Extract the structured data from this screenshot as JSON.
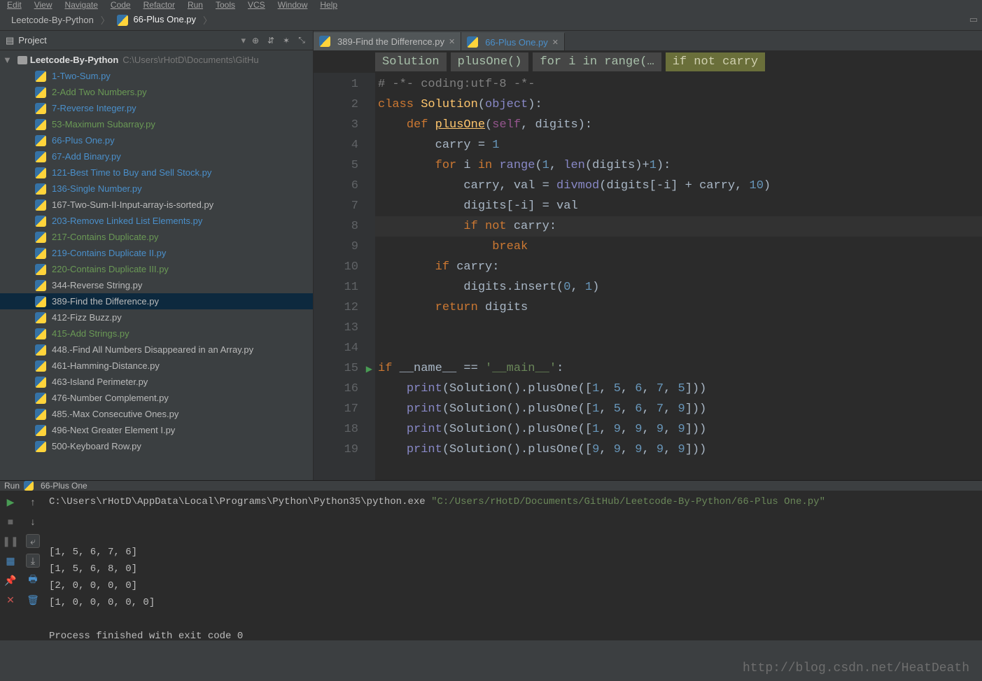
{
  "menu": [
    "Edit",
    "View",
    "Navigate",
    "Code",
    "Refactor",
    "Run",
    "Tools",
    "VCS",
    "Window",
    "Help"
  ],
  "breadcrumb": {
    "root": "Leetcode-By-Python",
    "file": "66-Plus One.py"
  },
  "project_panel": {
    "title": "Project",
    "root_name": "Leetcode-By-Python",
    "root_path": "C:\\Users\\rHotD\\Documents\\GitHu"
  },
  "files": [
    {
      "name": "1-Two-Sum.py",
      "status": "mod"
    },
    {
      "name": "2-Add Two Numbers.py",
      "status": "new"
    },
    {
      "name": "7-Reverse Integer.py",
      "status": "mod"
    },
    {
      "name": "53-Maximum Subarray.py",
      "status": "new"
    },
    {
      "name": "66-Plus One.py",
      "status": "mod"
    },
    {
      "name": "67-Add Binary.py",
      "status": "mod"
    },
    {
      "name": "121-Best Time to Buy and Sell Stock.py",
      "status": "mod"
    },
    {
      "name": "136-Single Number.py",
      "status": "mod"
    },
    {
      "name": "167-Two-Sum-II-Input-array-is-sorted.py",
      "status": ""
    },
    {
      "name": "203-Remove Linked List Elements.py",
      "status": "mod"
    },
    {
      "name": "217-Contains Duplicate.py",
      "status": "new"
    },
    {
      "name": "219-Contains Duplicate II.py",
      "status": "mod"
    },
    {
      "name": "220-Contains Duplicate III.py",
      "status": "new"
    },
    {
      "name": "344-Reverse String.py",
      "status": ""
    },
    {
      "name": "389-Find the Difference.py",
      "status": "",
      "selected": true
    },
    {
      "name": "412-Fizz Buzz.py",
      "status": ""
    },
    {
      "name": "415-Add Strings.py",
      "status": "new"
    },
    {
      "name": "448.-Find All Numbers Disappeared in an Array.py",
      "status": ""
    },
    {
      "name": "461-Hamming-Distance.py",
      "status": ""
    },
    {
      "name": "463-Island Perimeter.py",
      "status": ""
    },
    {
      "name": "476-Number Complement.py",
      "status": ""
    },
    {
      "name": "485.-Max Consecutive Ones.py",
      "status": ""
    },
    {
      "name": "496-Next Greater Element I.py",
      "status": ""
    },
    {
      "name": "500-Keyboard Row.py",
      "status": ""
    }
  ],
  "tabs": [
    {
      "name": "389-Find the Difference.py",
      "active": false,
      "status": ""
    },
    {
      "name": "66-Plus One.py",
      "active": true,
      "status": "mod"
    }
  ],
  "context": [
    "Solution",
    "plusOne()",
    "for i in range(…",
    "if not carry"
  ],
  "code_lines": [
    {
      "n": 1,
      "html": "<span class='cm'># -*- coding:utf-8 -*-</span>"
    },
    {
      "n": 2,
      "html": "<span class='kw'>class</span> <span class='fn'>Solution</span>(<span class='builtin'>object</span>):"
    },
    {
      "n": 3,
      "html": "    <span class='kw'>def</span> <span class='fnd'>plusOne</span>(<span class='self'>self</span>, digits):"
    },
    {
      "n": 4,
      "html": "        carry = <span class='num'>1</span>"
    },
    {
      "n": 5,
      "html": "        <span class='kw'>for</span> i <span class='kw'>in</span> <span class='builtin'>range</span>(<span class='num'>1</span>, <span class='builtin'>len</span>(digits)+<span class='num'>1</span>):"
    },
    {
      "n": 6,
      "html": "            carry, val = <span class='builtin'>divmod</span>(digits[-i] + carry, <span class='num'>10</span>)"
    },
    {
      "n": 7,
      "html": "            digits[-i] = val"
    },
    {
      "n": 8,
      "html": "            <span class='kw'>if not</span> carry:",
      "hl": true
    },
    {
      "n": 9,
      "html": "                <span class='kw'>break</span>"
    },
    {
      "n": 10,
      "html": "        <span class='kw'>if</span> carry:"
    },
    {
      "n": 11,
      "html": "            digits.insert(<span class='num'>0</span>, <span class='num'>1</span>)"
    },
    {
      "n": 12,
      "html": "        <span class='kw'>return</span> digits"
    },
    {
      "n": 13,
      "html": ""
    },
    {
      "n": 14,
      "html": ""
    },
    {
      "n": 15,
      "html": "<span class='kw'>if</span> __name__ == <span class='str'>'__main__'</span>:",
      "run": true
    },
    {
      "n": 16,
      "html": "    <span class='builtin'>print</span>(Solution().plusOne([<span class='num'>1</span>, <span class='num'>5</span>, <span class='num'>6</span>, <span class='num'>7</span>, <span class='num'>5</span>]))"
    },
    {
      "n": 17,
      "html": "    <span class='builtin'>print</span>(Solution().plusOne([<span class='num'>1</span>, <span class='num'>5</span>, <span class='num'>6</span>, <span class='num'>7</span>, <span class='num'>9</span>]))"
    },
    {
      "n": 18,
      "html": "    <span class='builtin'>print</span>(Solution().plusOne([<span class='num'>1</span>, <span class='num'>9</span>, <span class='num'>9</span>, <span class='num'>9</span>, <span class='num'>9</span>]))"
    },
    {
      "n": 19,
      "html": "    <span class='builtin'>print</span>(Solution().plusOne([<span class='num'>9</span>, <span class='num'>9</span>, <span class='num'>9</span>, <span class='num'>9</span>, <span class='num'>9</span>]))"
    }
  ],
  "run": {
    "label": "Run",
    "config": "66-Plus One",
    "cmd_prefix": "C:\\Users\\rHotD\\AppData\\Local\\Programs\\Python\\Python35\\python.exe ",
    "cmd_path": "\"C:/Users/rHotD/Documents/GitHub/Leetcode-By-Python/66-Plus One.py\"",
    "output": [
      "[1, 5, 6, 7, 6]",
      "[1, 5, 6, 8, 0]",
      "[2, 0, 0, 0, 0]",
      "[1, 0, 0, 0, 0, 0]",
      "",
      "Process finished with exit code 0"
    ]
  },
  "watermark": "http://blog.csdn.net/HeatDeath"
}
